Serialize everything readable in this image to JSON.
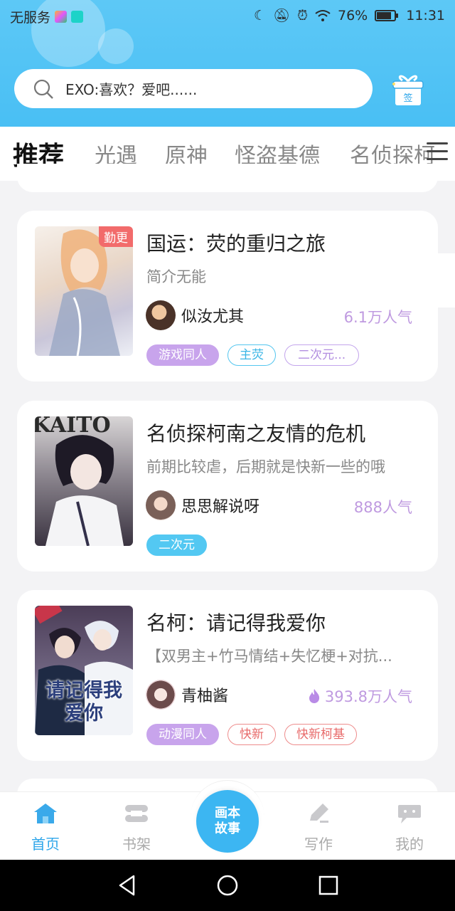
{
  "status_bar": {
    "carrier": "无服务",
    "battery": "76%",
    "time": "11:31"
  },
  "search": {
    "placeholder": "EXO:喜欢？爱吧......"
  },
  "header": {
    "checkin_icon": "gift-checkin-icon",
    "checkin_label": "签"
  },
  "tabs": [
    {
      "label": "推荐",
      "active": true
    },
    {
      "label": "光遇"
    },
    {
      "label": "原神"
    },
    {
      "label": "怪盗基德"
    },
    {
      "label": "名侦探柯"
    }
  ],
  "stories": [
    {
      "title": "国运：荧的重归之旅",
      "desc": "简介无能",
      "author": "似汝尤其",
      "popularity": "6.1万人气",
      "badge": "勤更",
      "tags": [
        "游戏同人",
        "主荧",
        "二次元..."
      ]
    },
    {
      "title": "名侦探柯南之友情的危机",
      "desc": "前期比较虐，后期就是快新一些的哦",
      "author": "思思解说呀",
      "popularity": "888人气",
      "tags": [
        "二次元"
      ]
    },
    {
      "title": "名柯：请记得我爱你",
      "desc": "【双男主+竹马情结+失忆梗+对抗...",
      "author": "青柚酱",
      "popularity": "393.8万人气",
      "tags": [
        "动漫同人",
        "快新",
        "快新柯基"
      ],
      "cover_text": "请记得我爱你"
    }
  ],
  "bottom_nav": {
    "home": "首页",
    "shelf": "书架",
    "center_line1": "画本",
    "center_line2": "故事",
    "write": "写作",
    "mine": "我的"
  },
  "colors": {
    "header_blue": "#49bff4",
    "accent_purple": "#a98de8",
    "popularity_purple": "#bf9ae0",
    "nav_active": "#2ea6ea"
  }
}
